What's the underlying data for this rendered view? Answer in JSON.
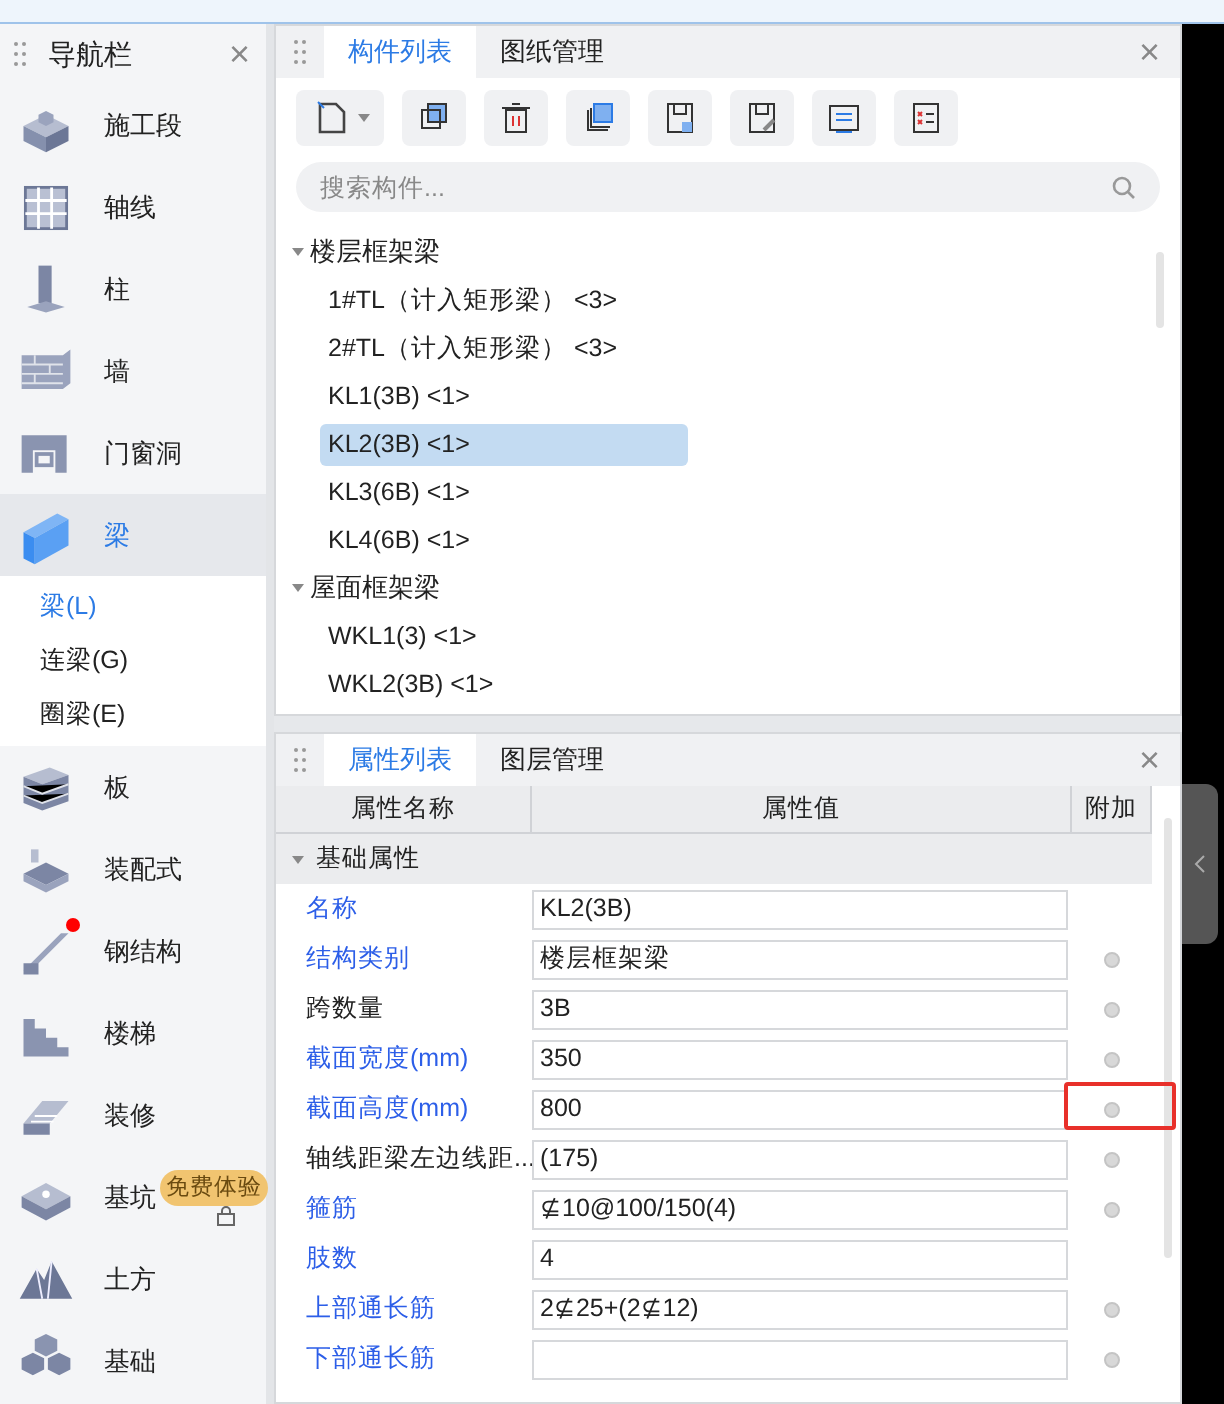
{
  "nav": {
    "title": "导航栏",
    "close": "×",
    "items": [
      {
        "label": "施工段",
        "selected": false,
        "badge": false
      },
      {
        "label": "轴线",
        "selected": false,
        "badge": false
      },
      {
        "label": "柱",
        "selected": false,
        "badge": false
      },
      {
        "label": "墙",
        "selected": false,
        "badge": false
      },
      {
        "label": "门窗洞",
        "selected": false,
        "badge": false
      },
      {
        "label": "梁",
        "selected": true,
        "badge": false,
        "children": [
          {
            "label": "梁(L)",
            "selected": true
          },
          {
            "label": "连梁(G)",
            "selected": false
          },
          {
            "label": "圈梁(E)",
            "selected": false
          }
        ]
      },
      {
        "label": "板",
        "selected": false,
        "badge": false
      },
      {
        "label": "装配式",
        "selected": false,
        "badge": false
      },
      {
        "label": "钢结构",
        "selected": false,
        "badge": true
      },
      {
        "label": "楼梯",
        "selected": false,
        "badge": false
      },
      {
        "label": "装修",
        "selected": false,
        "badge": false
      },
      {
        "label": "基坑",
        "selected": false,
        "badge": false,
        "promo": "免费体验"
      },
      {
        "label": "土方",
        "selected": false,
        "badge": false
      },
      {
        "label": "基础",
        "selected": false,
        "badge": false
      }
    ]
  },
  "component_panel": {
    "tabs": [
      {
        "label": "构件列表",
        "selected": true
      },
      {
        "label": "图纸管理",
        "selected": false
      }
    ],
    "close": "×",
    "search": {
      "placeholder": "搜索构件..."
    },
    "tree": [
      {
        "label": "楼层框架梁",
        "expanded": true,
        "children": [
          {
            "label": "1#TL（计入矩形梁） <3>",
            "selected": false
          },
          {
            "label": "2#TL（计入矩形梁） <3>",
            "selected": false
          },
          {
            "label": "KL1(3B) <1>",
            "selected": false
          },
          {
            "label": "KL2(3B) <1>",
            "selected": true
          },
          {
            "label": "KL3(6B) <1>",
            "selected": false
          },
          {
            "label": "KL4(6B) <1>",
            "selected": false
          }
        ]
      },
      {
        "label": "屋面框架梁",
        "expanded": true,
        "children": [
          {
            "label": "WKL1(3) <1>",
            "selected": false
          },
          {
            "label": "WKL2(3B) <1>",
            "selected": false
          }
        ]
      }
    ]
  },
  "property_panel": {
    "tabs": [
      {
        "label": "属性列表",
        "selected": true
      },
      {
        "label": "图层管理",
        "selected": false
      }
    ],
    "close": "×",
    "columns": [
      "属性名称",
      "属性值",
      "附加"
    ],
    "group": {
      "label": "基础属性",
      "expanded": true
    },
    "rows": [
      {
        "name": "名称",
        "value": "KL2(3B)",
        "public": true,
        "has_option": false,
        "marked": false
      },
      {
        "name": "结构类别",
        "value": "楼层框架梁",
        "public": true,
        "has_option": true,
        "marked": false
      },
      {
        "name": "跨数量",
        "value": "3B",
        "public": false,
        "has_option": true,
        "marked": false
      },
      {
        "name": "截面宽度(mm)",
        "value": "350",
        "public": true,
        "has_option": true,
        "marked": false
      },
      {
        "name": "截面高度(mm)",
        "value": "800",
        "public": true,
        "has_option": true,
        "marked": true
      },
      {
        "name": "轴线距梁左边线距...",
        "value": "(175)",
        "public": false,
        "has_option": true,
        "marked": false
      },
      {
        "name": "箍筋",
        "value": "⊈10@100/150(4)",
        "public": true,
        "has_option": true,
        "marked": false
      },
      {
        "name": "肢数",
        "value": "4",
        "public": true,
        "has_option": false,
        "marked": false
      },
      {
        "name": "上部通长筋",
        "value": "2⊈25+(2⊈12)",
        "public": true,
        "has_option": true,
        "marked": false
      },
      {
        "name": "下部通长筋",
        "value": "",
        "public": true,
        "has_option": true,
        "marked": false
      }
    ]
  }
}
